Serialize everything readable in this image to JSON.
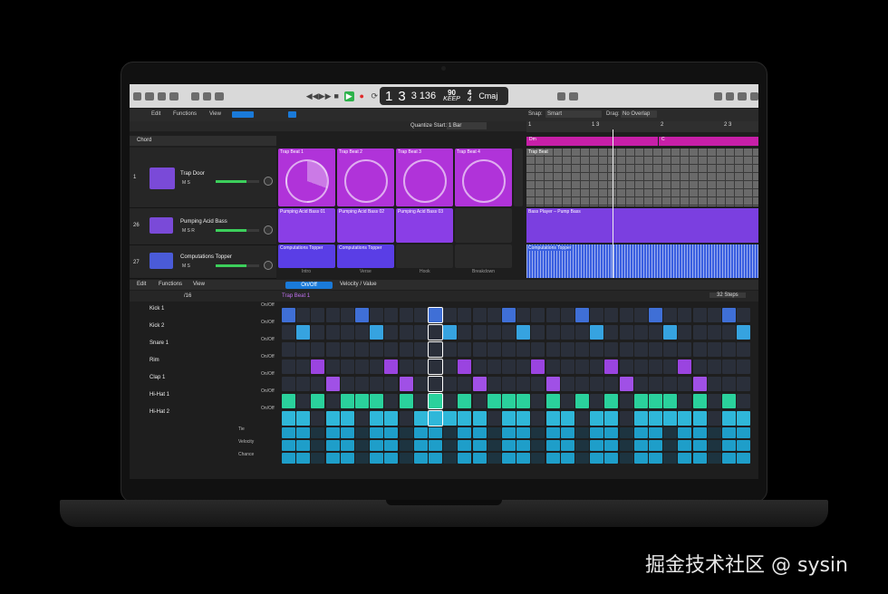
{
  "transport": {
    "bar": "1",
    "beat": "3",
    "div": "3",
    "tick": "136",
    "tempo": "90",
    "tempo_unit": "KEEP",
    "time_sig_top": "4",
    "time_sig_bottom": "4",
    "key": "Cmaj"
  },
  "toolbar": {
    "edit": "Edit",
    "functions": "Functions",
    "view": "View",
    "snap_label": "Snap:",
    "snap_value": "Smart",
    "drag_label": "Drag:",
    "drag_value": "No Overlap",
    "quantize_label": "Quantize Start:",
    "quantize_value": "1 Bar"
  },
  "ruler": {
    "m1": "1",
    "m13": "1 3",
    "m2": "2",
    "m23": "2 3"
  },
  "chord_header": "Chord",
  "tracks": [
    {
      "num": "1",
      "name": "Trap Door",
      "ms": "M S"
    },
    {
      "num": "26",
      "name": "Pumping Acid Bass",
      "ms": "M S R"
    },
    {
      "num": "27",
      "name": "Computations Topper",
      "ms": "M S"
    }
  ],
  "live_cells": {
    "row1": [
      "Trap Beat 1",
      "Trap Beat 2",
      "Trap Beat 3",
      "Trap Beat 4"
    ],
    "row2": [
      "Pumping Acid Bass 01",
      "Pumping Acid Bass 02",
      "Pumping Acid Bass 03"
    ],
    "row3": [
      "Computations Topper",
      "Computations Topper"
    ],
    "scenes": [
      "Intro",
      "Verse",
      "Hook",
      "Breakdown"
    ]
  },
  "regions": {
    "chord_a": "Dm",
    "chord_b": "C",
    "trap": "Trap Beat",
    "bass": "Bass Player – Pump Bass",
    "topper": "Computations Topper"
  },
  "seq": {
    "edit": "Edit",
    "functions": "Functions",
    "view": "View",
    "onoff": "On/Off",
    "velocity": "Velocity / Value",
    "pattern_name": "Trap Beat 1",
    "rate": "/16",
    "steps": "32 Steps",
    "rows": [
      {
        "name": "Kick 1",
        "mode": "On/Off",
        "color": "#3f6fd6"
      },
      {
        "name": "Kick 2",
        "mode": "On/Off",
        "color": "#36a3e0"
      },
      {
        "name": "Snare 1",
        "mode": "On/Off",
        "color": "#8a3de0"
      },
      {
        "name": "Rim",
        "mode": "On/Off",
        "color": "#9a44e0"
      },
      {
        "name": "Clap 1",
        "mode": "On/Off",
        "color": "#a050e6"
      },
      {
        "name": "Hi-Hat 1",
        "mode": "On/Off",
        "color": "#2ad19c"
      },
      {
        "name": "Hi-Hat 2",
        "mode": "On/Off",
        "color": "#2fb7d9"
      }
    ],
    "sub_rows": [
      "Tie",
      "Velocity",
      "Chance"
    ]
  },
  "watermark": "掘金技术社区 @ sysin"
}
